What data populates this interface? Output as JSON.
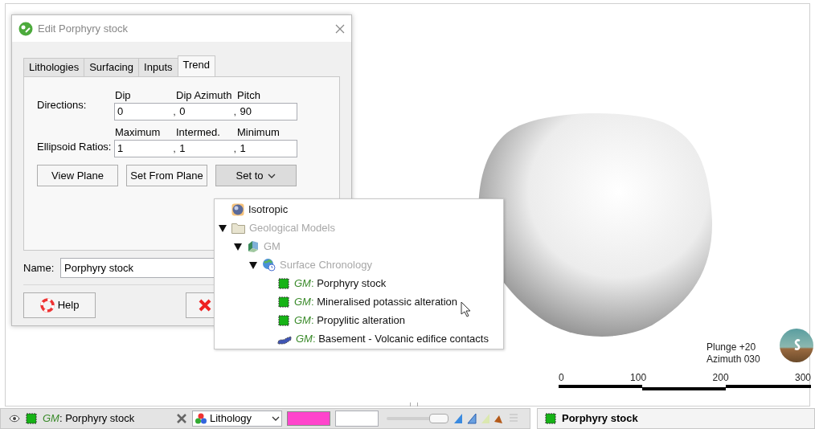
{
  "dialog": {
    "title": "Edit Porphyry stock",
    "tabs": [
      {
        "label": "Lithologies",
        "selected": false
      },
      {
        "label": "Surfacing",
        "selected": false
      },
      {
        "label": "Inputs",
        "selected": false
      },
      {
        "label": "Trend",
        "selected": true
      }
    ],
    "directions": {
      "label": "Directions:",
      "columns": [
        "Dip",
        "Dip Azimuth",
        "Pitch"
      ],
      "values": [
        "0",
        "0",
        "90"
      ],
      "separator": ","
    },
    "ratios": {
      "label": "Ellipsoid Ratios:",
      "columns": [
        "Maximum",
        "Intermed.",
        "Minimum"
      ],
      "values": [
        "1",
        "1",
        "1"
      ],
      "separator": ","
    },
    "buttons": [
      {
        "label": "View Plane",
        "kind": "plain"
      },
      {
        "label": "Set From Plane",
        "kind": "plain"
      },
      {
        "label": "Set to",
        "kind": "menu"
      }
    ],
    "name": {
      "label": "Name:",
      "value": "Porphyry stock"
    },
    "help_button": "Help"
  },
  "set_to_menu": [
    {
      "kind": "sphere",
      "label": "Isotropic",
      "disabled": false
    },
    {
      "kind": "folder",
      "label": "Geological Models",
      "disabled": true,
      "expanded": true,
      "children": [
        {
          "kind": "model",
          "label": "GM",
          "disabled": true,
          "expanded": true,
          "children": [
            {
              "kind": "chronology",
              "label": "Surface Chronology",
              "disabled": true,
              "expanded": true,
              "children": [
                {
                  "kind": "volume",
                  "prefix": "GM",
                  "separator": ":",
                  "label": "Porphyry stock",
                  "disabled": false
                },
                {
                  "kind": "volume",
                  "prefix": "GM",
                  "separator": ":",
                  "label": "Mineralised potassic alteration",
                  "disabled": false
                },
                {
                  "kind": "volume",
                  "prefix": "GM",
                  "separator": ":",
                  "label": "Propylitic alteration",
                  "disabled": false
                },
                {
                  "kind": "surface",
                  "prefix": "GM",
                  "separator": ":",
                  "label": "Basement - Volcanic edifice contacts",
                  "disabled": false
                }
              ]
            }
          ]
        }
      ]
    }
  ],
  "viewer": {
    "plunge": "Plunge +20",
    "azimuth": "Azimuth 030",
    "scale_labels": [
      "0",
      "100",
      "200",
      "300"
    ]
  },
  "status_bar": {
    "item": {
      "prefix": "GM",
      "separator": ":",
      "label": "Porphyry stock"
    },
    "colour_by": "Lithology",
    "swatch": {
      "color": "#ff44cc"
    },
    "opacity": {
      "level": 0.86
    },
    "selected_object": "Porphyry stock"
  }
}
